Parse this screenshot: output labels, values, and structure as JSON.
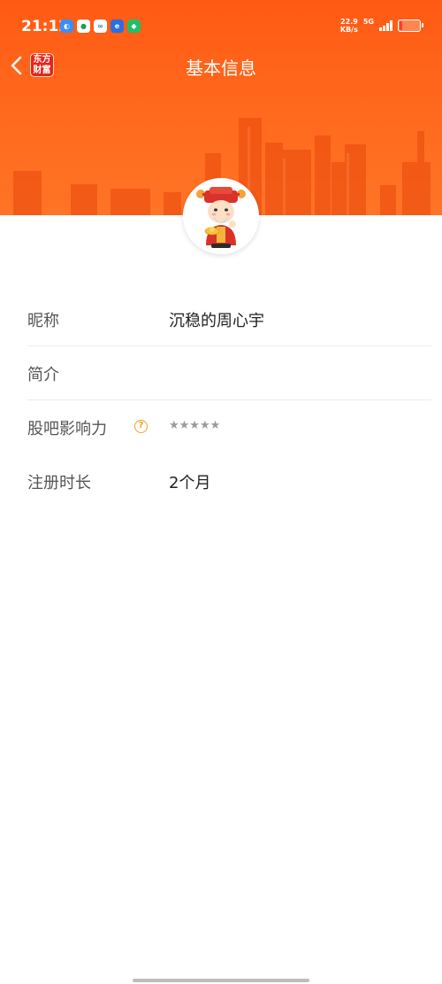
{
  "status_bar": {
    "time": "21:12",
    "net_speed_value": "22.9",
    "net_speed_unit": "KB/s",
    "net_type": "5G",
    "battery_level": 0.15
  },
  "header": {
    "back_icon": "chevron-left-icon",
    "logo_line1": "东方",
    "logo_line2": "财富",
    "title": "基本信息"
  },
  "profile": {
    "avatar_icon": "caishen-avatar"
  },
  "info": {
    "nickname_label": "昵称",
    "nickname_value": "沉稳的周心宇",
    "intro_label": "简介",
    "intro_value": "",
    "influence_label": "股吧影响力",
    "influence_stars": "★★★★★",
    "register_label": "注册时长",
    "register_value": "2个月"
  },
  "colors": {
    "header_orange": "#ff5a14",
    "help_icon": "#f0a020",
    "star_gray": "#9a9a9a"
  }
}
